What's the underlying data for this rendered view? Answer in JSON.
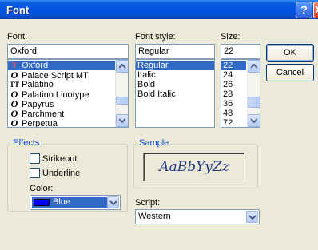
{
  "window": {
    "title": "Font",
    "help_glyph": "?",
    "close_glyph": "✕"
  },
  "font": {
    "label": "Font:",
    "value": "Oxford",
    "items": [
      {
        "name": "Oxford",
        "icon": "truetype-icon",
        "glyph": "Ŧ",
        "selected": true
      },
      {
        "name": "Palace Script MT",
        "icon": "opentype-icon",
        "glyph": "O",
        "selected": false
      },
      {
        "name": "Palatino",
        "icon": "truetype-icon",
        "glyph": "TT",
        "selected": false
      },
      {
        "name": "Palatino Linotype",
        "icon": "opentype-icon",
        "glyph": "O",
        "selected": false
      },
      {
        "name": "Papyrus",
        "icon": "opentype-icon",
        "glyph": "O",
        "selected": false
      },
      {
        "name": "Parchment",
        "icon": "opentype-icon",
        "glyph": "O",
        "selected": false
      },
      {
        "name": "Perpetua",
        "icon": "opentype-icon",
        "glyph": "O",
        "selected": false
      }
    ]
  },
  "style": {
    "label": "Font style:",
    "value": "Regular",
    "items": [
      "Regular",
      "Italic",
      "Bold",
      "Bold Italic"
    ],
    "selected_index": 0
  },
  "size": {
    "label": "Size:",
    "value": "22",
    "items": [
      "22",
      "24",
      "26",
      "28",
      "36",
      "48",
      "72"
    ],
    "selected_index": 0
  },
  "buttons": {
    "ok": "OK",
    "cancel": "Cancel"
  },
  "effects": {
    "title": "Effects",
    "strikeout": {
      "label": "Strikeout",
      "checked": false
    },
    "underline": {
      "label": "Underline",
      "checked": false
    },
    "color_label": "Color:",
    "color_value": "Blue",
    "color_hex": "#0000ff"
  },
  "sample": {
    "title": "Sample",
    "text": "AaBbYyZz"
  },
  "script": {
    "label": "Script:",
    "value": "Western"
  },
  "colors": {
    "title_bar": "#0054e3",
    "selection": "#316ac5",
    "group_title": "#0046d5",
    "dialog_bg": "#ece9d8"
  }
}
